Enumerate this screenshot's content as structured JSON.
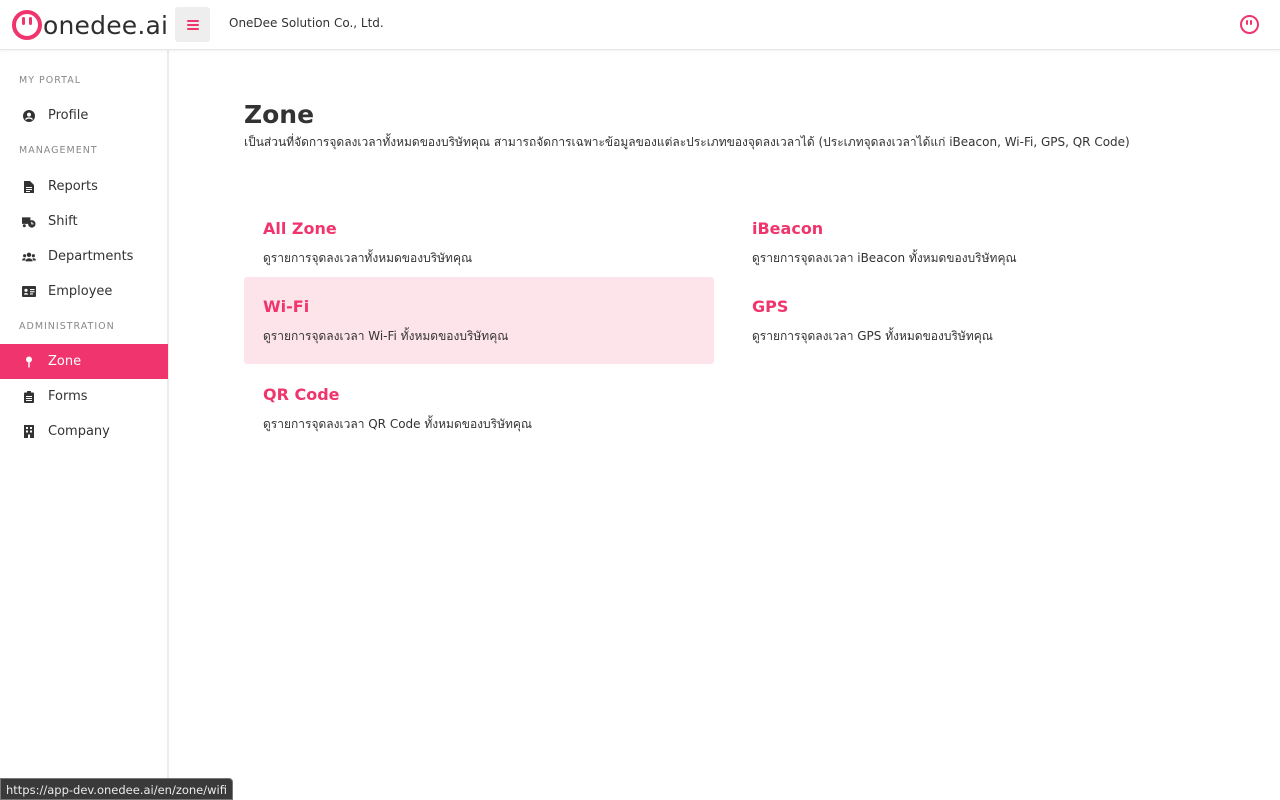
{
  "app": {
    "brand": "onedee.ai",
    "company": "OneDee Solution Co., Ltd."
  },
  "sidebar": {
    "sections": [
      {
        "label": "MY PORTAL"
      },
      {
        "label": "MANAGEMENT"
      },
      {
        "label": "ADMINISTRATION"
      }
    ],
    "items": [
      {
        "label": "Profile",
        "icon": "user-circle-icon"
      },
      {
        "label": "Reports",
        "icon": "file-icon"
      },
      {
        "label": "Shift",
        "icon": "truck-clock-icon"
      },
      {
        "label": "Departments",
        "icon": "users-icon"
      },
      {
        "label": "Employee",
        "icon": "id-card-icon"
      },
      {
        "label": "Zone",
        "icon": "map-pin-icon",
        "active": true
      },
      {
        "label": "Forms",
        "icon": "clipboard-icon"
      },
      {
        "label": "Company",
        "icon": "building-icon"
      }
    ]
  },
  "main": {
    "title": "Zone",
    "description": "เป็นส่วนที่จัดการจุดลงเวลาทั้งหมดของบริษัทคุณ สามารถจัดการเฉพาะข้อมูลของแต่ละประเภทของจุดลงเวลาได้ (ประเภทจุดลงเวลาได้แก่ iBeacon, Wi-Fi, GPS, QR Code)",
    "cards": [
      {
        "title": "All Zone",
        "desc": "ดูรายการจุดลงเวลาทั้งหมดของบริษัทคุณ"
      },
      {
        "title": "iBeacon",
        "desc": "ดูรายการจุดลงเวลา iBeacon ทั้งหมดของบริษัทคุณ"
      },
      {
        "title": "Wi-Fi",
        "desc": "ดูรายการจุดลงเวลา Wi-Fi ทั้งหมดของบริษัทคุณ"
      },
      {
        "title": "GPS",
        "desc": "ดูรายการจุดลงเวลา GPS ทั้งหมดของบริษัทคุณ"
      },
      {
        "title": "QR Code",
        "desc": "ดูรายการจุดลงเวลา QR Code ทั้งหมดของบริษัทคุณ"
      }
    ]
  },
  "status_bar": {
    "url": "https://app-dev.onedee.ai/en/zone/wifi"
  },
  "colors": {
    "accent": "#f0356e",
    "hover": "#fde4ea",
    "text": "#333333"
  }
}
